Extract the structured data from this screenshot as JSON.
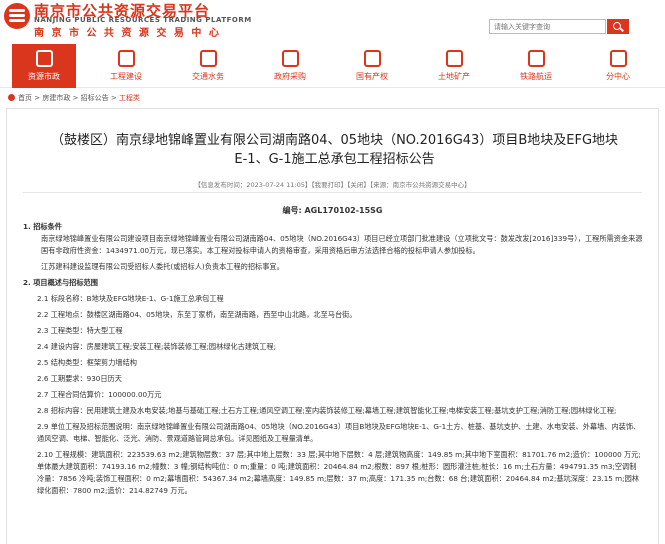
{
  "header": {
    "title_cn": "南京市公共资源交易平台",
    "title_en": "NANJING PUBLIC RESOURCES TRADING PLATFORM",
    "subtitle_cn": "南 京 市 公 共 资 源 交 易 中 心",
    "search_placeholder": "请输入关键字查询"
  },
  "nav": [
    {
      "label": "资源市政",
      "icon": "city-icon",
      "active": true
    },
    {
      "label": "工程建设",
      "icon": "construction-icon",
      "active": false
    },
    {
      "label": "交通水务",
      "icon": "traffic-icon",
      "active": false
    },
    {
      "label": "政府采购",
      "icon": "purchase-icon",
      "active": false
    },
    {
      "label": "国有产权",
      "icon": "property-icon",
      "active": false
    },
    {
      "label": "土地矿产",
      "icon": "land-icon",
      "active": false
    },
    {
      "label": "铁路航运",
      "icon": "railway-icon",
      "active": false
    },
    {
      "label": "分中心",
      "icon": "branch-icon",
      "active": false
    }
  ],
  "breadcrumb": {
    "items": [
      "首页",
      "房建市政",
      "招标公告"
    ],
    "current": "工程类"
  },
  "notice": {
    "title": "（鼓楼区）南京绿地锦峰置业有限公司湖南路04、05地块（NO.2016G43）项目B地块及EFG地块E-1、G-1施工总承包工程招标公告",
    "meta": "【信息发布时间：2023-07-24 11:05】【我要打印】【关闭】【来源：南京市公共资源交易中心】",
    "doc_no": "编号: AGL170102-15SG",
    "s1_heading": "1. 招标条件",
    "s1_p1": "南京绿地锦峰置业有限公司建设项目南京绿地锦峰置业有限公司湖南路04、05地块（NO.2016G43）项目已经立项部门批准建设（立项批文号：鼓发改发[2016]339号），工程所需资金来源国有非政府性资金：1434971.00万元，现已落实。本工程对投标申请人的资格审查，采用资格后审方法选择合格的投标申请人参加投标。",
    "s1_p2": "江苏建科建设监理有限公司受招标人委托(或招标人)负责本工程的招标事宜。",
    "s2_heading": "2. 项目概述与招标范围",
    "items": [
      "2.1 标段名称：B地块及EFG地块E-1、G-1施工总承包工程",
      "2.2 工程地点：鼓楼区湖南路04、05地块，东至丁家桥，南至湖南路，西至中山北路，北至马台街。",
      "2.3 工程类型：特大型工程",
      "2.4 建设内容：房屋建筑工程;安装工程;装饰装修工程;园林绿化古建筑工程;",
      "2.5 结构类型：框架剪力墙结构",
      "2.6 工期要求：930日历天",
      "2.7 工程合同估算价：100000.00万元",
      "2.8 招标内容：民用建筑土建及水电安装;地基与基础工程;土石方工程;通风空调工程;室内装饰装修工程;幕墙工程;建筑智能化工程;电梯安装工程;基坑支护工程;消防工程;园林绿化工程;",
      "2.9 单位工程及招标范围说明：南京绿地锦峰置业有限公司湖南路04、05地块（NO.2016G43）项目B地块及EFG地块E-1、G-1土方、桩基、基坑支护、土建、水电安装、外幕墙、内装饰、通风空调、电梯、智能化、泛光、消防、景观道路管网总承包。详见图纸及工程量清单。",
      "2.10 工程规模：建筑面积：223539.63 m2;建筑物层数：37 层;其中地上层数：33 层;其中地下层数：4 层;建筑物高度：149.85 m;其中地下室面积：81701.76 m2;造价：100000 万元;单体最大建筑面积：74193.16 m2;幢数：3 幢;钢结构吨位：0 m;重量：0 吨;建筑面积：20464.84 m2;根数：897 根;桩形：圆形灌注桩;桩长：16 m;土石方量：494791.35 m3;空调制冷量：7856 冷吨;装饰工程面积：0 m2;幕墙面积：54367.34 m2;幕墙高度：149.85 m;层数：37 m;高度：171.35 m;台数：68 台;建筑面积：20464.84 m2;基坑深度：23.15 m;园林绿化面积：7800 m2;造价：214.82749 万元。"
    ]
  }
}
